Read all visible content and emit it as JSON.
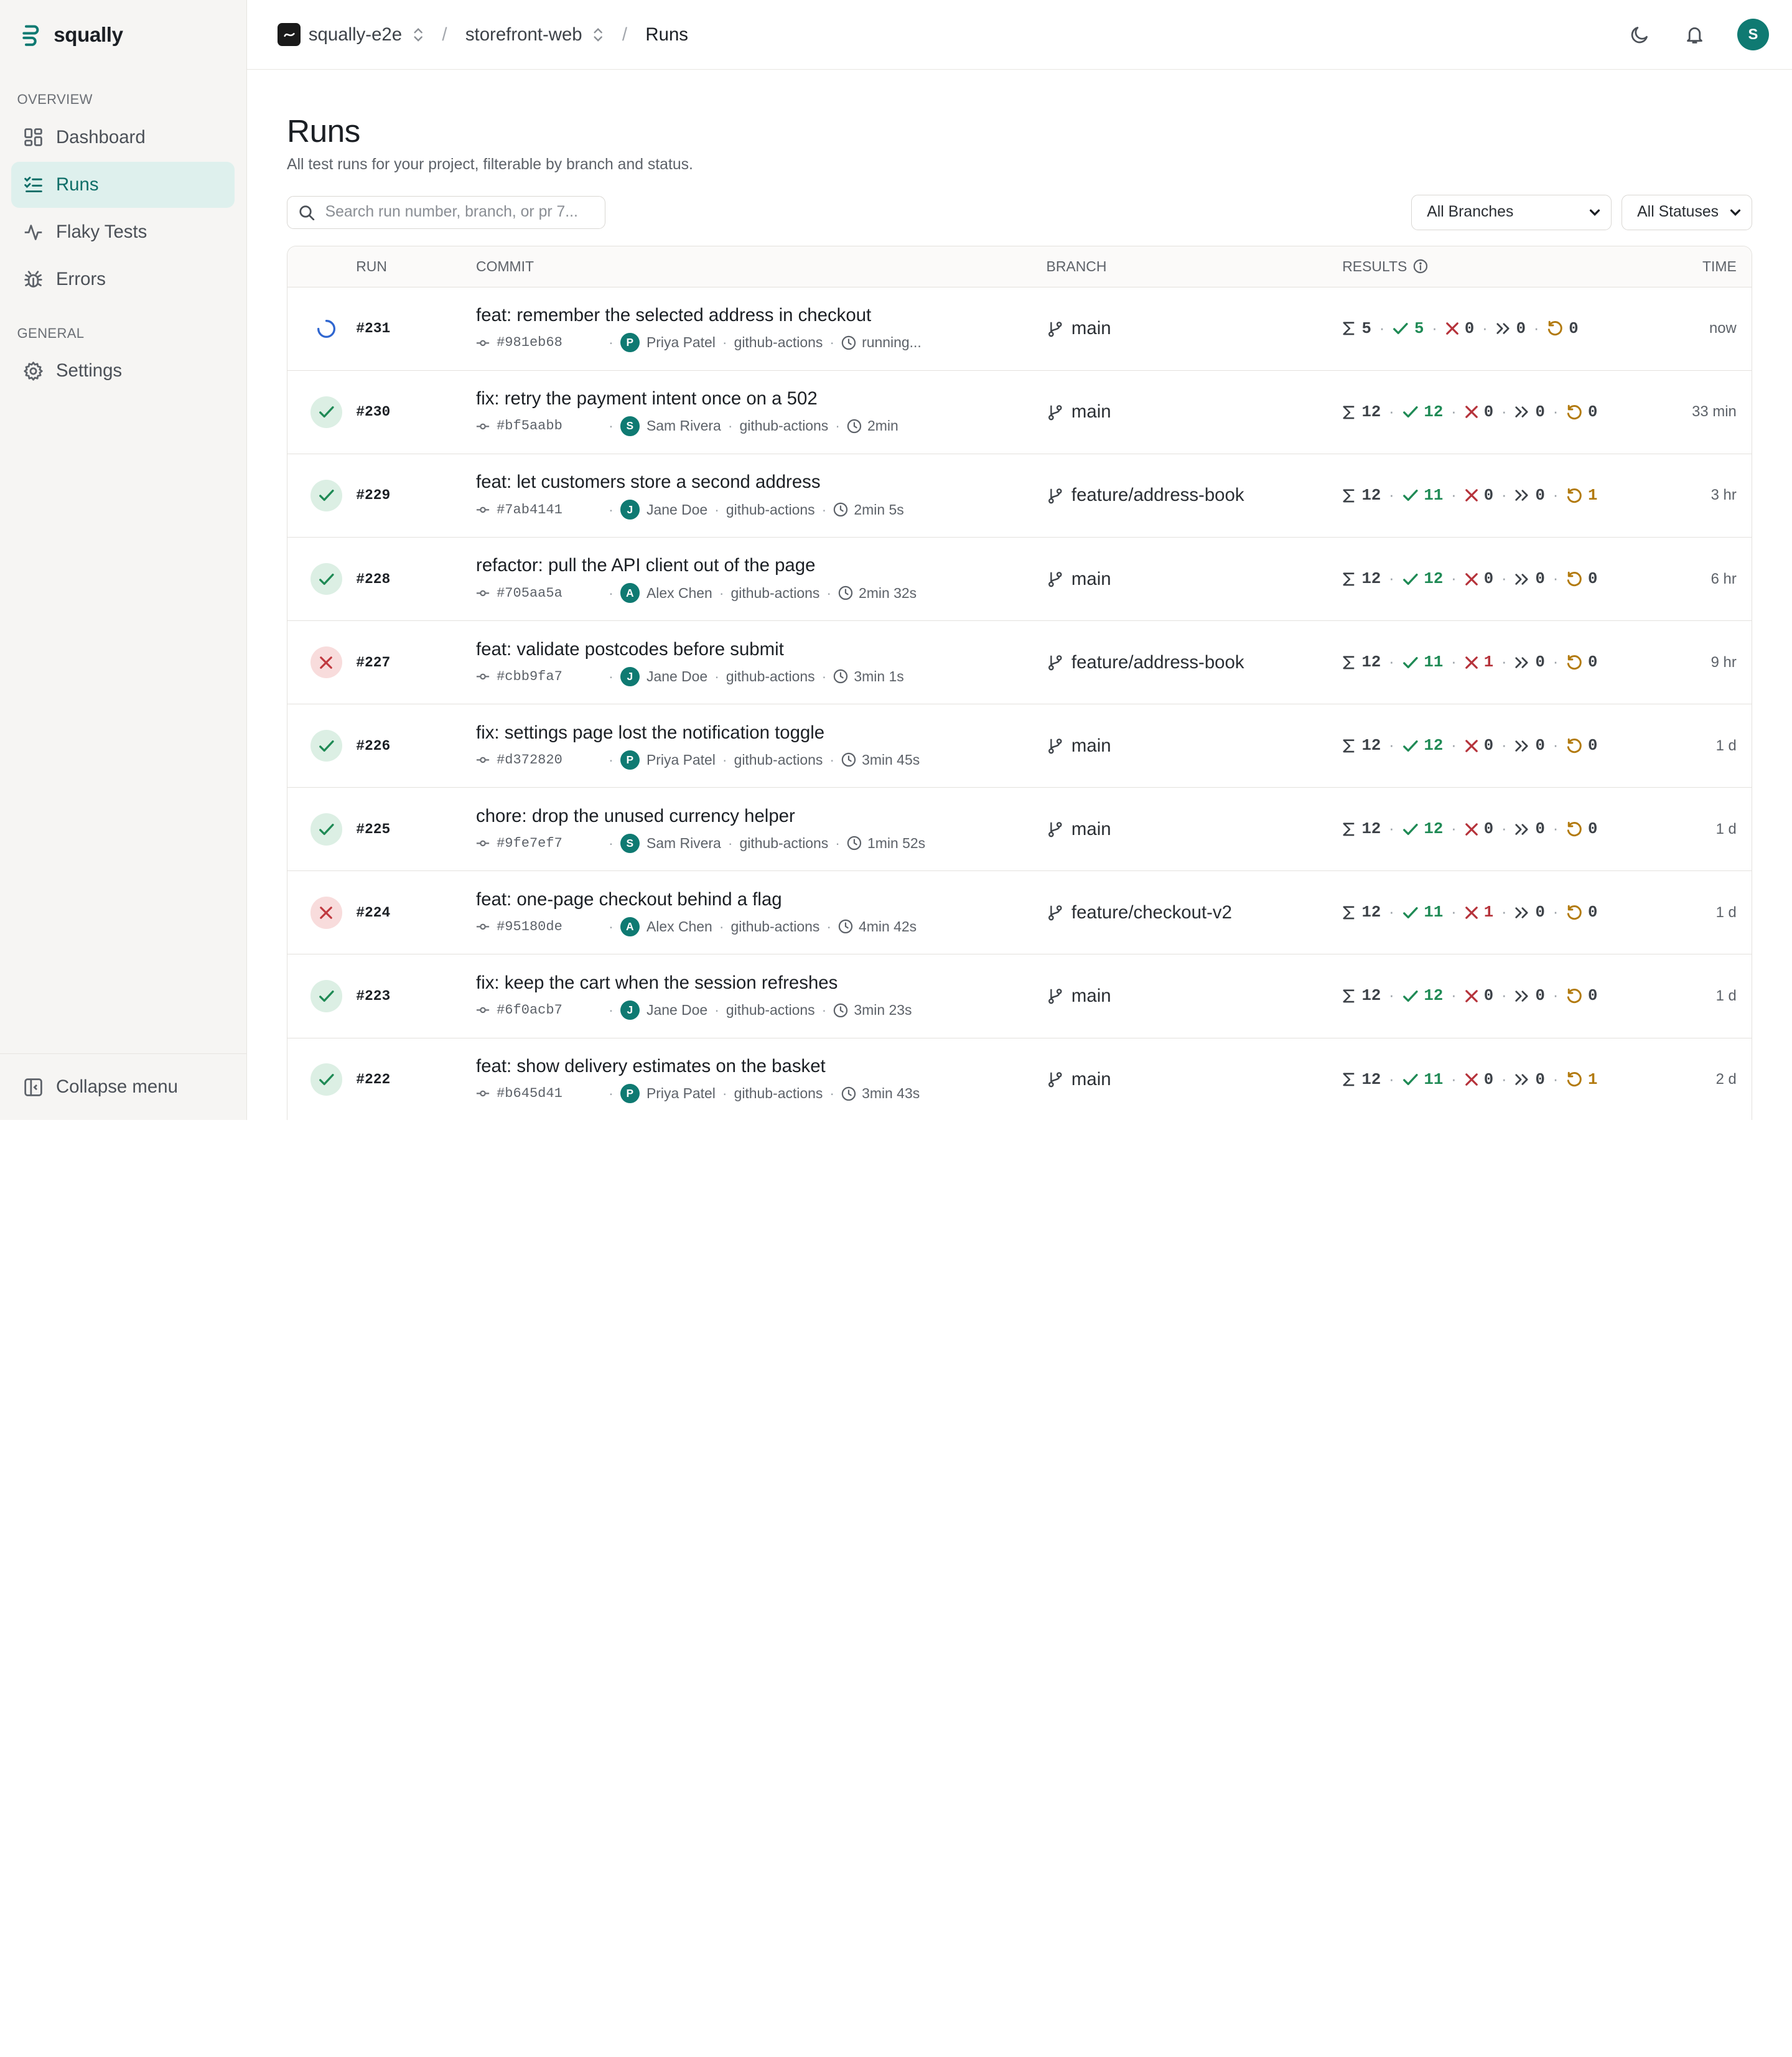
{
  "brand": {
    "name": "squally"
  },
  "sidebar": {
    "sections": {
      "overview": "OVERVIEW",
      "general": "GENERAL"
    },
    "items": [
      {
        "label": "Dashboard",
        "icon": "dashboard-icon"
      },
      {
        "label": "Runs",
        "icon": "runs-icon",
        "active": true
      },
      {
        "label": "Flaky Tests",
        "icon": "activity-icon"
      },
      {
        "label": "Errors",
        "icon": "bug-icon"
      }
    ],
    "settings": {
      "label": "Settings",
      "icon": "gear-icon"
    },
    "collapse": {
      "label": "Collapse menu",
      "icon": "collapse-icon"
    }
  },
  "topbar": {
    "org": "squally-e2e",
    "project": "storefront-web",
    "current": "Runs",
    "avatar_initial": "S"
  },
  "page": {
    "title": "Runs",
    "subtitle": "All test runs for your project, filterable by branch and status."
  },
  "filters": {
    "search_placeholder": "Search run number, branch, or pr 7...",
    "branch_select": "All Branches",
    "status_select": "All Statuses"
  },
  "table": {
    "headers": {
      "run": "RUN",
      "commit": "COMMIT",
      "branch": "BRANCH",
      "results": "RESULTS",
      "time": "TIME"
    },
    "rows": [
      {
        "status": "running",
        "run": "#231",
        "title": "feat: remember the selected address in checkout",
        "sha": "#981eb68",
        "author": "Priya Patel",
        "initial": "P",
        "ci": "github-actions",
        "duration": "running...",
        "branch": "main",
        "total": "5",
        "passed": "5",
        "failed": "0",
        "skipped": "0",
        "retried": "0",
        "time": "now"
      },
      {
        "status": "passed",
        "run": "#230",
        "title": "fix: retry the payment intent once on a 502",
        "sha": "#bf5aabb",
        "author": "Sam Rivera",
        "initial": "S",
        "ci": "github-actions",
        "duration": "2min",
        "branch": "main",
        "total": "12",
        "passed": "12",
        "failed": "0",
        "skipped": "0",
        "retried": "0",
        "time": "33 min"
      },
      {
        "status": "passed",
        "run": "#229",
        "title": "feat: let customers store a second address",
        "sha": "#7ab4141",
        "author": "Jane Doe",
        "initial": "J",
        "ci": "github-actions",
        "duration": "2min 5s",
        "branch": "feature/address-book",
        "total": "12",
        "passed": "11",
        "failed": "0",
        "skipped": "0",
        "retried": "1",
        "time": "3 hr"
      },
      {
        "status": "passed",
        "run": "#228",
        "title": "refactor: pull the API client out of the page",
        "sha": "#705aa5a",
        "author": "Alex Chen",
        "initial": "A",
        "ci": "github-actions",
        "duration": "2min 32s",
        "branch": "main",
        "total": "12",
        "passed": "12",
        "failed": "0",
        "skipped": "0",
        "retried": "0",
        "time": "6 hr"
      },
      {
        "status": "failed",
        "run": "#227",
        "title": "feat: validate postcodes before submit",
        "sha": "#cbb9fa7",
        "author": "Jane Doe",
        "initial": "J",
        "ci": "github-actions",
        "duration": "3min 1s",
        "branch": "feature/address-book",
        "total": "12",
        "passed": "11",
        "failed": "1",
        "skipped": "0",
        "retried": "0",
        "time": "9 hr"
      },
      {
        "status": "passed",
        "run": "#226",
        "title": "fix: settings page lost the notification toggle",
        "sha": "#d372820",
        "author": "Priya Patel",
        "initial": "P",
        "ci": "github-actions",
        "duration": "3min 45s",
        "branch": "main",
        "total": "12",
        "passed": "12",
        "failed": "0",
        "skipped": "0",
        "retried": "0",
        "time": "1 d"
      },
      {
        "status": "passed",
        "run": "#225",
        "title": "chore: drop the unused currency helper",
        "sha": "#9fe7ef7",
        "author": "Sam Rivera",
        "initial": "S",
        "ci": "github-actions",
        "duration": "1min 52s",
        "branch": "main",
        "total": "12",
        "passed": "12",
        "failed": "0",
        "skipped": "0",
        "retried": "0",
        "time": "1 d"
      },
      {
        "status": "failed",
        "run": "#224",
        "title": "feat: one-page checkout behind a flag",
        "sha": "#95180de",
        "author": "Alex Chen",
        "initial": "A",
        "ci": "github-actions",
        "duration": "4min 42s",
        "branch": "feature/checkout-v2",
        "total": "12",
        "passed": "11",
        "failed": "1",
        "skipped": "0",
        "retried": "0",
        "time": "1 d"
      },
      {
        "status": "passed",
        "run": "#223",
        "title": "fix: keep the cart when the session refreshes",
        "sha": "#6f0acb7",
        "author": "Jane Doe",
        "initial": "J",
        "ci": "github-actions",
        "duration": "3min 23s",
        "branch": "main",
        "total": "12",
        "passed": "12",
        "failed": "0",
        "skipped": "0",
        "retried": "0",
        "time": "1 d"
      },
      {
        "status": "passed",
        "run": "#222",
        "title": "feat: show delivery estimates on the basket",
        "sha": "#b645d41",
        "author": "Priya Patel",
        "initial": "P",
        "ci": "github-actions",
        "duration": "3min 43s",
        "branch": "main",
        "total": "12",
        "passed": "11",
        "failed": "0",
        "skipped": "0",
        "retried": "1",
        "time": "2 d"
      }
    ]
  },
  "colors": {
    "accent": "#0f7a72",
    "active_nav_bg": "#def0ed",
    "pass": "#1f8a55",
    "fail": "#b5323a",
    "retry": "#b27a0e"
  }
}
